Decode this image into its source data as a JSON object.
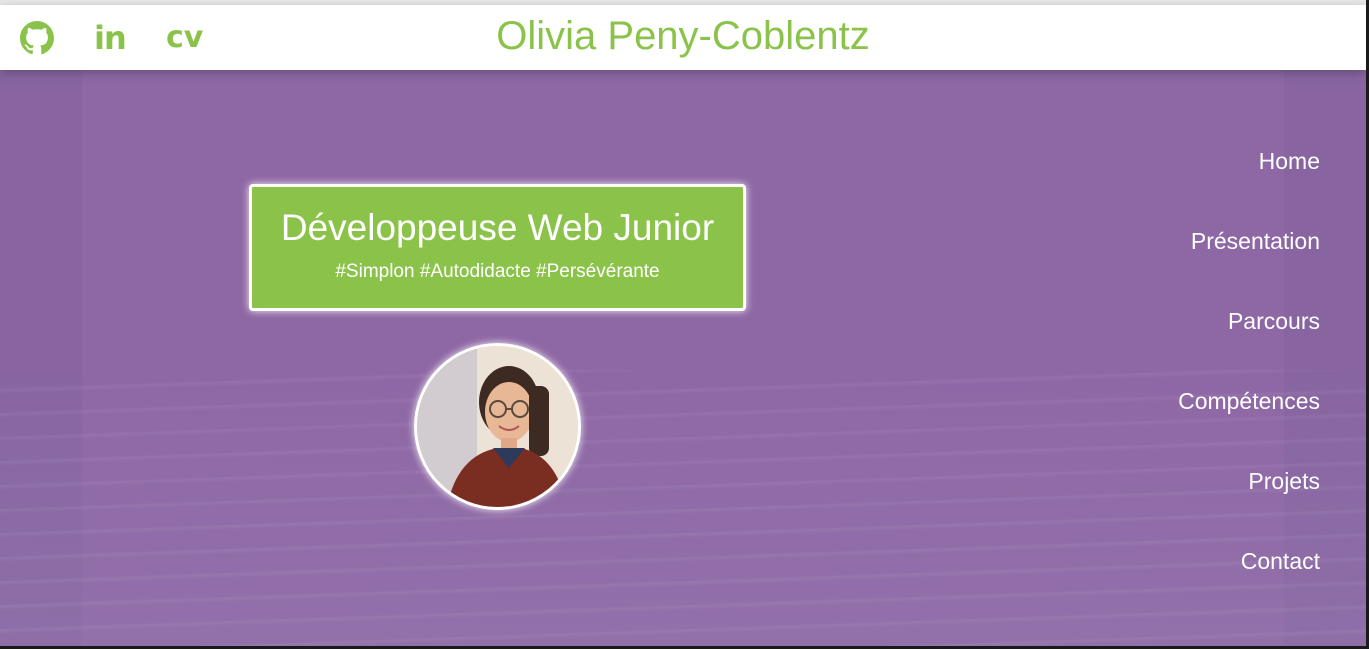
{
  "header": {
    "title": "Olivia Peny-Coblentz",
    "social": {
      "github_icon": "github-icon",
      "linkedin_label": "in",
      "cv_label": "cv"
    }
  },
  "hero": {
    "heading": "Développeuse Web Junior",
    "tags": "#Simplon #Autodidacte #Persévérante"
  },
  "nav": {
    "items": [
      {
        "label": "Home"
      },
      {
        "label": "Présentation"
      },
      {
        "label": "Parcours"
      },
      {
        "label": "Compétences"
      },
      {
        "label": "Projets"
      },
      {
        "label": "Contact"
      }
    ]
  },
  "colors": {
    "accent": "#8bc34a",
    "hero_bg": "#8e68a5",
    "text_light": "#ffffff"
  }
}
